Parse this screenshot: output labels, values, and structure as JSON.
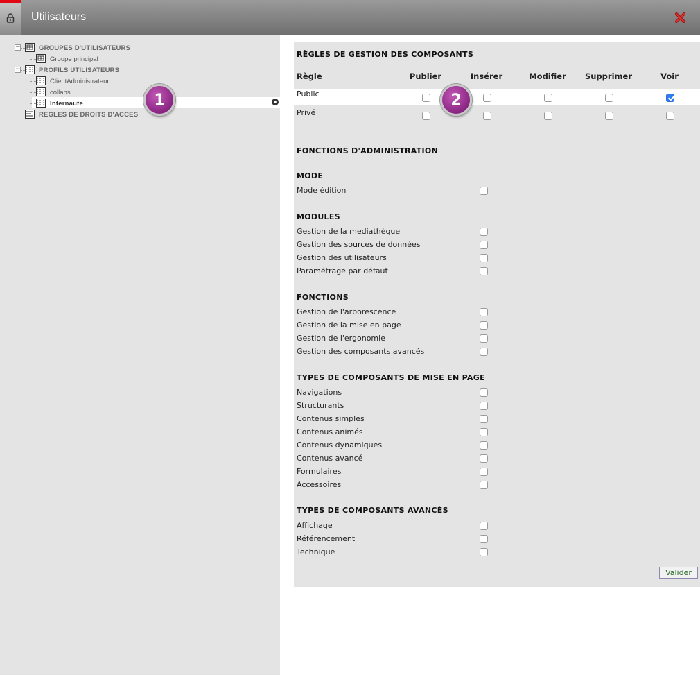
{
  "window": {
    "title": "Utilisateurs"
  },
  "colors": {
    "accent_red": "#e30613",
    "callout": "#8a2582",
    "checked": "#2e7df0"
  },
  "tree": {
    "items": [
      {
        "label": "GROUPES D'UTILISATEURS",
        "icon": "group-icon",
        "bold": true
      },
      {
        "label": "Groupe principal",
        "icon": "group-icon",
        "bold": false
      },
      {
        "label": "PROFILS UTILISATEURS",
        "icon": "profile-icon",
        "bold": true
      },
      {
        "label": "ClientAdministrateur",
        "icon": "profile-icon",
        "bold": false
      },
      {
        "label": "collabs",
        "icon": "profile-icon",
        "bold": false
      },
      {
        "label": "Internaute",
        "icon": "profile-icon",
        "bold": true,
        "selected": true
      },
      {
        "label": "REGLES DE DROITS D'ACCES",
        "icon": "rules-icon",
        "bold": true
      }
    ]
  },
  "callouts": {
    "one": "1",
    "two": "2"
  },
  "rules": {
    "title": "RÈGLES DE GESTION DES COMPOSANTS",
    "headers": [
      "Règle",
      "Publier",
      "Insérer",
      "Modifier",
      "Supprimer",
      "Voir"
    ],
    "rows": [
      {
        "label": "Public",
        "values": [
          false,
          false,
          false,
          false,
          true
        ]
      },
      {
        "label": "Privé",
        "values": [
          false,
          false,
          false,
          false,
          false
        ]
      }
    ]
  },
  "admin": {
    "title": "FONCTIONS D'ADMINISTRATION",
    "sections": [
      {
        "title": "MODE",
        "items": [
          "Mode édition"
        ]
      },
      {
        "title": "MODULES",
        "items": [
          "Gestion de la mediathèque",
          "Gestion des sources de données",
          "Gestion des utilisateurs",
          "Paramétrage par défaut"
        ]
      },
      {
        "title": "FONCTIONS",
        "items": [
          "Gestion de l'arborescence",
          "Gestion de la mise en page",
          "Gestion de l'ergonomie",
          "Gestion des composants avancés"
        ]
      },
      {
        "title": "TYPES DE COMPOSANTS DE MISE EN PAGE",
        "items": [
          "Navigations",
          "Structurants",
          "Contenus simples",
          "Contenus animés",
          "Contenus dynamiques",
          "Contenus avancé",
          "Formulaires",
          "Accessoires"
        ]
      },
      {
        "title": "TYPES DE COMPOSANTS AVANCÉS",
        "items": [
          "Affichage",
          "Référencement",
          "Technique"
        ]
      }
    ]
  },
  "buttons": {
    "valider": "Valider"
  }
}
